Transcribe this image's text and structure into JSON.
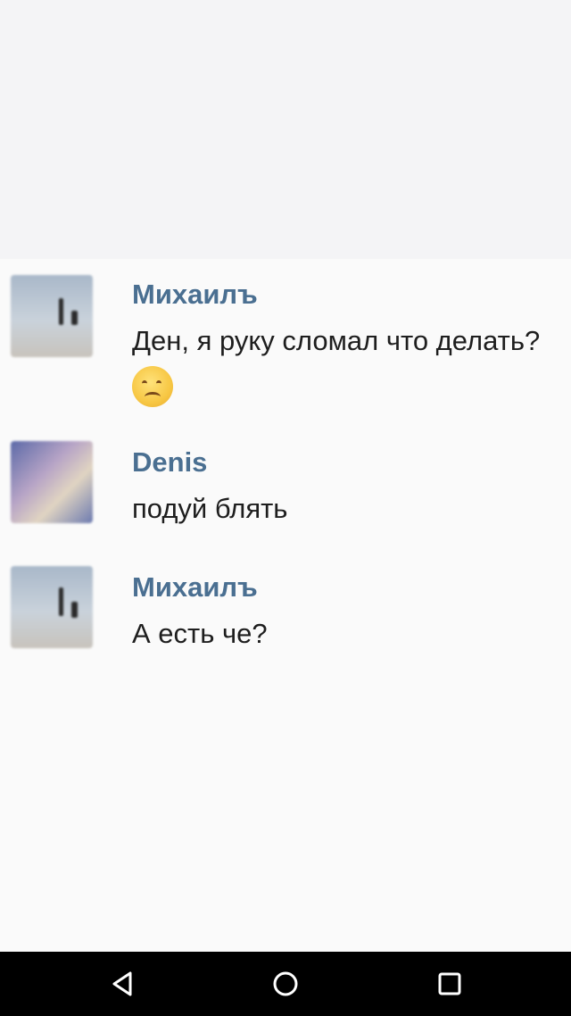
{
  "messages": [
    {
      "sender": "Михаилъ",
      "text": "Ден, я руку сломал что делать?",
      "emoji": "worried-face-emoji"
    },
    {
      "sender": "Denis",
      "text": "подуй блять"
    },
    {
      "sender": "Михаилъ",
      "text": "А есть че?"
    }
  ],
  "navbar": {
    "icons": [
      "back-icon",
      "home-icon",
      "recents-icon"
    ]
  },
  "colors": {
    "sender_name": "#4a6f91",
    "message_text": "#1e1e1e",
    "background": "#fafafa",
    "navbar": "#000000"
  }
}
